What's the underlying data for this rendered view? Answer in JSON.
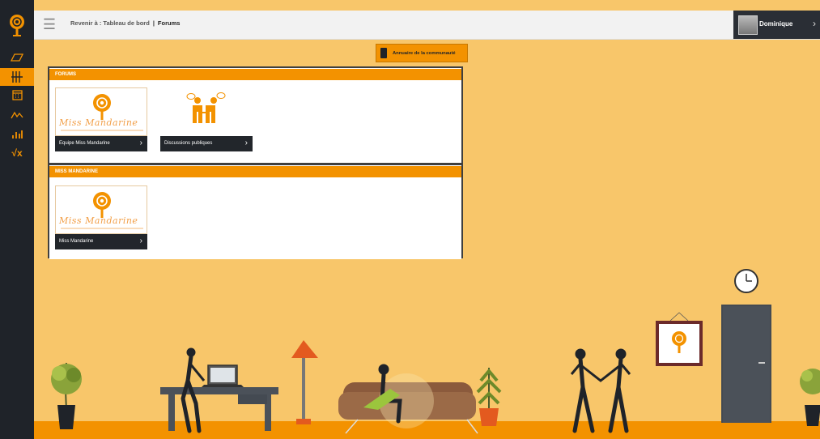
{
  "topbar": {
    "back_label": "Revenir à : Tableau de bord",
    "separator": "|",
    "current": "Forums"
  },
  "user": {
    "name": "Dominique",
    "chevron": "›"
  },
  "directory_button": {
    "label": "Annuaire de la communauté"
  },
  "sidebar": {
    "items": [
      {
        "icon": "book-icon"
      },
      {
        "icon": "forum-icon",
        "active": true
      },
      {
        "icon": "calendar-icon"
      },
      {
        "icon": "activity-icon"
      },
      {
        "icon": "stats-icon"
      },
      {
        "icon": "math-icon"
      }
    ]
  },
  "sections": [
    {
      "title": "FORUMS",
      "cards": [
        {
          "label": "Equipe Miss Mandarine",
          "thumb_text": "Miss Mandarine"
        },
        {
          "label": "Discussions publiques"
        }
      ]
    },
    {
      "title": "MISS MANDARINE",
      "cards": [
        {
          "label": "Miss Mandarine",
          "thumb_text": "Miss Mandarine"
        }
      ]
    }
  ],
  "colors": {
    "accent": "#f39200",
    "dark": "#1f2329",
    "wall": "#f8c66a"
  }
}
